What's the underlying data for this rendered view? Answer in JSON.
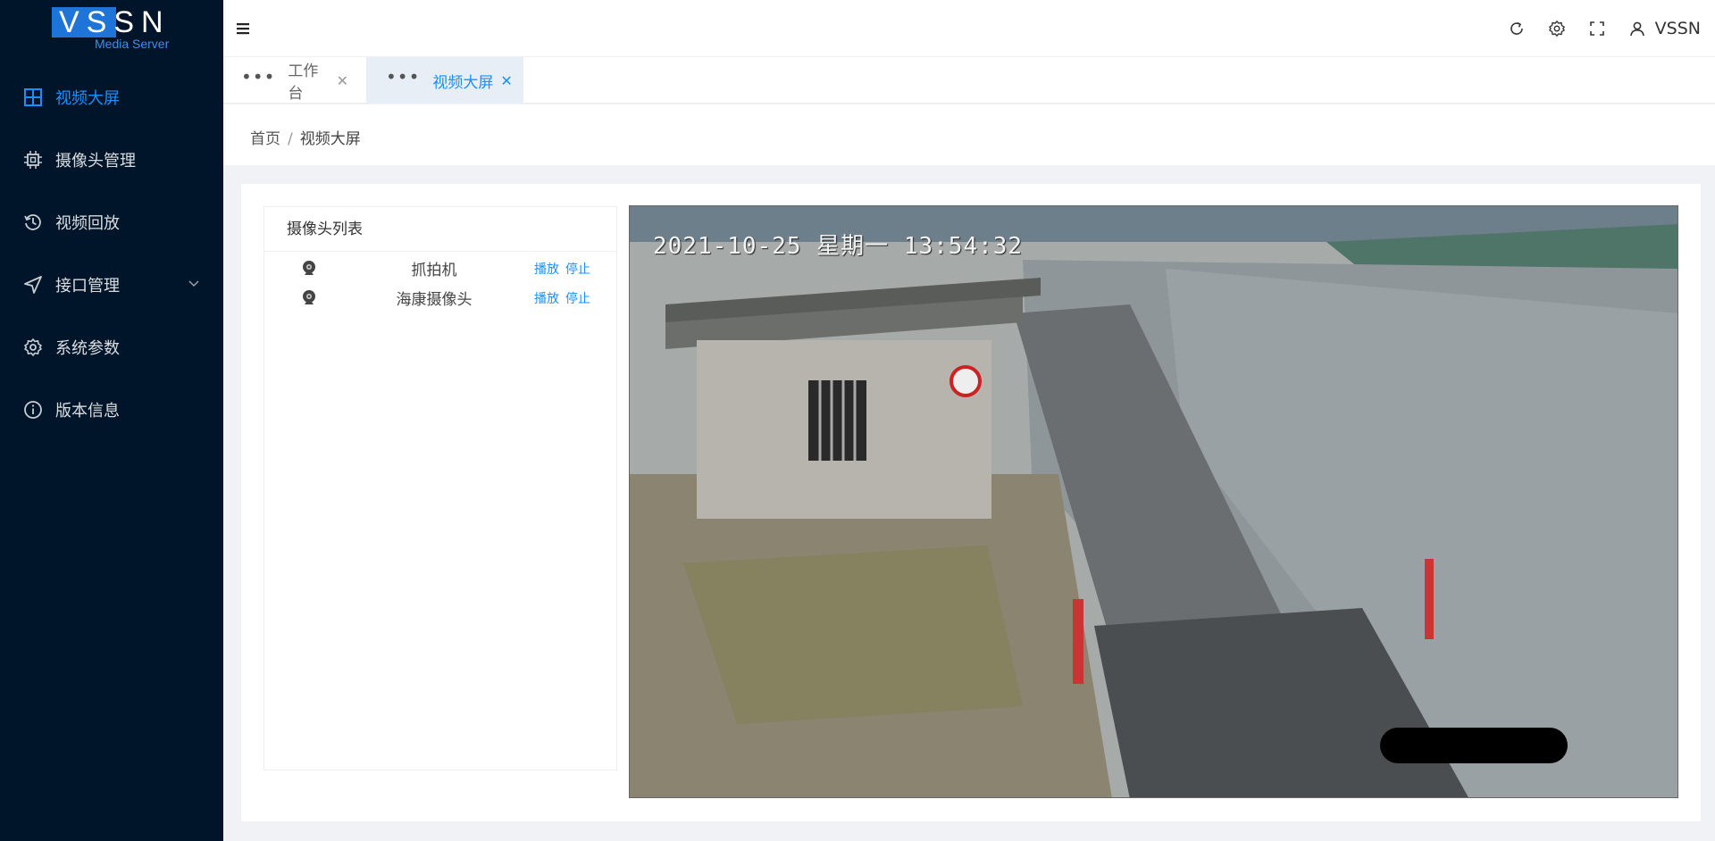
{
  "logo": {
    "text": "VSSN",
    "subtitle": "Media Server"
  },
  "sidebar": {
    "items": [
      {
        "label": "视频大屏",
        "icon": "grid-icon",
        "active": true
      },
      {
        "label": "摄像头管理",
        "icon": "chip-icon",
        "active": false
      },
      {
        "label": "视频回放",
        "icon": "history-icon",
        "active": false
      },
      {
        "label": "接口管理",
        "icon": "send-icon",
        "active": false,
        "expandable": true
      },
      {
        "label": "系统参数",
        "icon": "gear-icon",
        "active": false
      },
      {
        "label": "版本信息",
        "icon": "info-icon",
        "active": false
      }
    ]
  },
  "header": {
    "user": "VSSN",
    "icons": [
      "refresh-icon",
      "settings-icon",
      "fullscreen-icon",
      "user-icon"
    ]
  },
  "tabs": [
    {
      "label": "工作台",
      "active": false
    },
    {
      "label": "视频大屏",
      "active": true
    }
  ],
  "breadcrumb": {
    "home": "首页",
    "separator": "/",
    "current": "视频大屏"
  },
  "camera_list": {
    "title": "摄像头列表",
    "play_label": "播放",
    "stop_label": "停止",
    "items": [
      {
        "name": "抓拍机"
      },
      {
        "name": "海康摄像头"
      }
    ]
  },
  "video": {
    "timestamp": "2021-10-25 星期一 13:54:32"
  },
  "colors": {
    "sidebar_bg": "#001529",
    "accent": "#1890ff",
    "logo_blue": "#1f74d8"
  }
}
